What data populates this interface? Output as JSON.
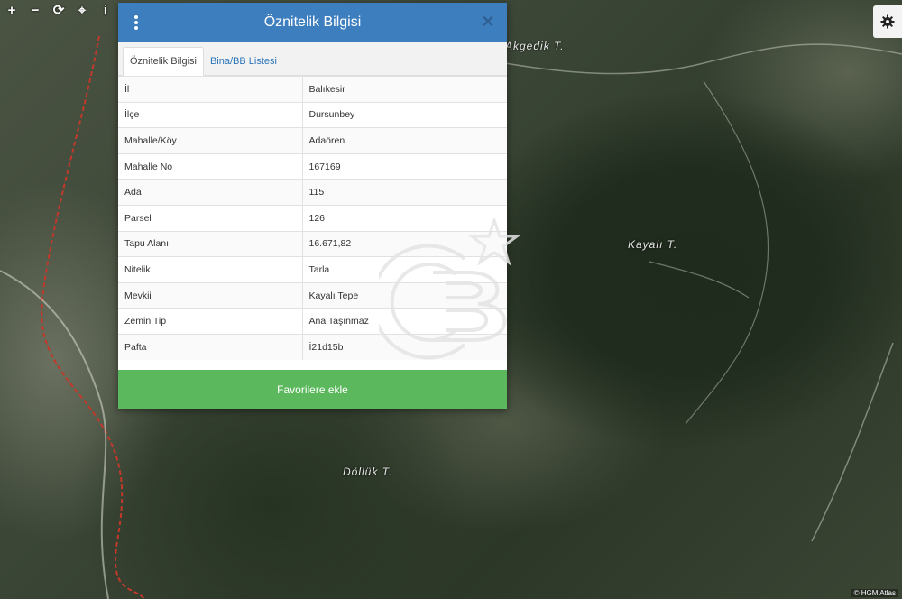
{
  "map": {
    "tools": [
      "+",
      "−",
      "⟳",
      "⌖",
      "i"
    ],
    "labels": [
      "Akgedik T.",
      "Kayalı T.",
      "Döllük T."
    ],
    "attribution": "© HGM Atlas"
  },
  "panel": {
    "title": "Öznitelik Bilgisi",
    "close_symbol": "✕",
    "tabs": [
      {
        "label": "Öznitelik Bilgisi",
        "active": true
      },
      {
        "label": "Bina/BB Listesi",
        "active": false
      }
    ],
    "rows": [
      {
        "key": "İl",
        "value": "Balıkesir"
      },
      {
        "key": "İlçe",
        "value": "Dursunbey"
      },
      {
        "key": "Mahalle/Köy",
        "value": "Adaören"
      },
      {
        "key": "Mahalle No",
        "value": "167169"
      },
      {
        "key": "Ada",
        "value": "115"
      },
      {
        "key": "Parsel",
        "value": "126"
      },
      {
        "key": "Tapu Alanı",
        "value": "16.671,82"
      },
      {
        "key": "Nitelik",
        "value": "Tarla"
      },
      {
        "key": "Mevkii",
        "value": "Kayalı Tepe"
      },
      {
        "key": "Zemin Tip",
        "value": "Ana Taşınmaz"
      },
      {
        "key": "Pafta",
        "value": "İ21d15b"
      }
    ],
    "favorite_button": "Favorilere ekle"
  },
  "colors": {
    "header": "#3d7ebf",
    "favorite": "#5cb85c",
    "tab_link": "#2a74b8"
  }
}
